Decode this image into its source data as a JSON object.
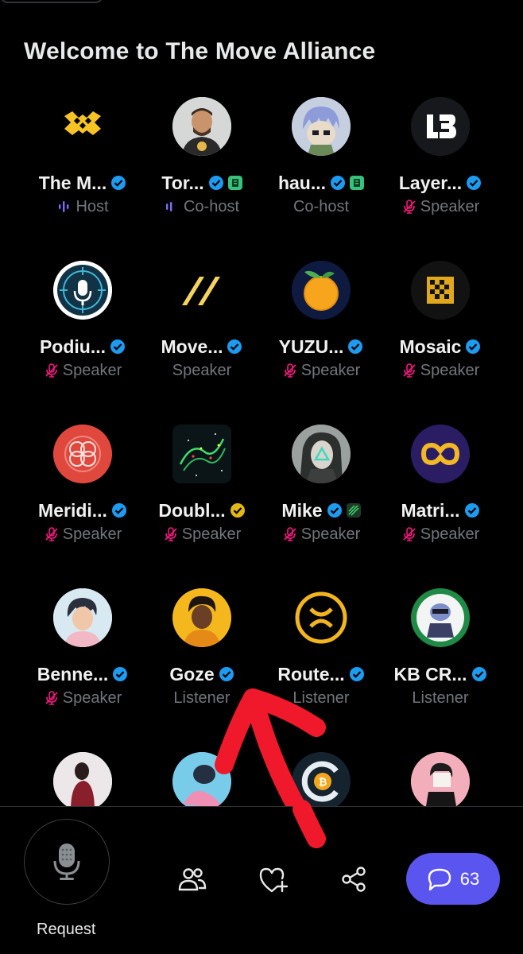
{
  "title": "Welcome to The Move Alliance",
  "participants": [
    {
      "name": "The M...",
      "role": "Host",
      "role_icon": "speaking-wave-icon",
      "avatar": "move-alliance-logo"
    },
    {
      "name": "Tor...",
      "role": "Co-host",
      "role_icon": "speaking-wave-icon",
      "avatar": "person-photo"
    },
    {
      "name": "hau...",
      "role": "Co-host",
      "role_icon": "none",
      "avatar": "anime-character"
    },
    {
      "name": "Layer...",
      "role": "Speaker",
      "role_icon": "mic-muted-icon",
      "avatar": "lb-logo"
    },
    {
      "name": "Podiu...",
      "role": "Speaker",
      "role_icon": "mic-muted-icon",
      "avatar": "podium-mic-logo"
    },
    {
      "name": "Move...",
      "role": "Speaker",
      "role_icon": "none",
      "avatar": "move-logo"
    },
    {
      "name": "YUZU...",
      "role": "Speaker",
      "role_icon": "mic-muted-icon",
      "avatar": "yuzu-fruit"
    },
    {
      "name": "Mosaic",
      "role": "Speaker",
      "role_icon": "mic-muted-icon",
      "avatar": "mosaic-logo"
    },
    {
      "name": "Meridi...",
      "role": "Speaker",
      "role_icon": "mic-muted-icon",
      "avatar": "meridian-logo"
    },
    {
      "name": "Doubl...",
      "role": "Speaker",
      "role_icon": "mic-muted-icon",
      "avatar": "double-art"
    },
    {
      "name": "Mike",
      "role": "Speaker",
      "role_icon": "mic-muted-icon",
      "avatar": "mike-art"
    },
    {
      "name": "Matri...",
      "role": "Speaker",
      "role_icon": "mic-muted-icon",
      "avatar": "matrix-logo"
    },
    {
      "name": "Benne...",
      "role": "Speaker",
      "role_icon": "mic-muted-icon",
      "avatar": "bennett-art"
    },
    {
      "name": "Goze",
      "role": "Listener",
      "role_icon": "none",
      "avatar": "goze-art"
    },
    {
      "name": "Route...",
      "role": "Listener",
      "role_icon": "none",
      "avatar": "router-logo"
    },
    {
      "name": "KB CR...",
      "role": "Listener",
      "role_icon": "none",
      "avatar": "kb-art"
    }
  ],
  "bottom": {
    "request_label": "Request",
    "chat_count": "63"
  },
  "colors": {
    "background": "#000000",
    "verified_blue": "#1d9bf0",
    "verified_gold": "#e2b719",
    "accent_purple": "#5b55f0",
    "muted_red": "#f4212e",
    "secondary_text": "#71767b"
  }
}
